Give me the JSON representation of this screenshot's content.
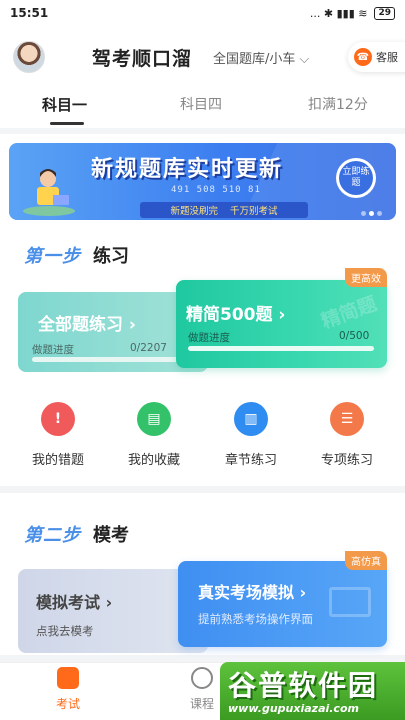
{
  "status_bar": {
    "time": "15:51",
    "icons": "... ✱ ▮▮▮ ≋",
    "battery": "29"
  },
  "header": {
    "title": "驾考顺口溜",
    "question_bank": "全国题库/小车",
    "service": "客服"
  },
  "tabs": [
    {
      "label": "科目一",
      "active": true
    },
    {
      "label": "科目四",
      "active": false
    },
    {
      "label": "扣满12分",
      "active": false
    }
  ],
  "banner": {
    "title": "新规题库实时更新",
    "numbers": "491  508  510  81",
    "sub_left": "新题没刷完",
    "sub_right": "千万别考试",
    "button": "立即练题"
  },
  "step1": {
    "num": "第一步",
    "text": "练习",
    "all_practice": {
      "label": "全部题练习",
      "progress_label": "做题进度",
      "progress": "0/2207"
    },
    "simplified": {
      "label": "精简500题",
      "progress_label": "做题进度",
      "progress": "0/500",
      "tag": "更高效",
      "watermark": "精简题"
    },
    "shortcuts": [
      {
        "label": "我的错题",
        "icon": "wrong-questions-icon",
        "color": "#f05a5a",
        "glyph": "!"
      },
      {
        "label": "我的收藏",
        "icon": "favorites-icon",
        "color": "#33c26a",
        "glyph": "▤"
      },
      {
        "label": "章节练习",
        "icon": "chapter-practice-icon",
        "color": "#2f8cf0",
        "glyph": "▥"
      },
      {
        "label": "专项练习",
        "icon": "special-practice-icon",
        "color": "#f4794a",
        "glyph": "☰"
      }
    ]
  },
  "step2": {
    "num": "第二步",
    "text": "模考",
    "mock": {
      "label": "模拟考试",
      "sub": "点我去模考"
    },
    "real": {
      "label": "真实考场模拟",
      "sub": "提前熟悉考场操作界面",
      "tag": "高仿真"
    }
  },
  "bottom_nav": [
    {
      "label": "考试",
      "active": true
    },
    {
      "label": "课程",
      "active": false
    }
  ],
  "watermark": {
    "big": "谷普软件园",
    "url": "www.gupuxiazai.com"
  }
}
